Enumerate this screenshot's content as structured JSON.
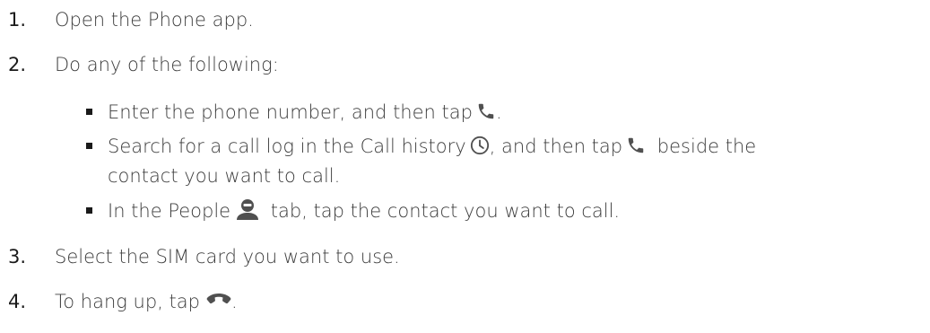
{
  "steps": [
    {
      "number": "1.",
      "text": "Open the Phone app."
    },
    {
      "number": "2.",
      "text": "Do any of the following:"
    },
    {
      "number": "3.",
      "text": "Select the SIM card you want to use."
    },
    {
      "number": "4.",
      "text_before": "To hang up, tap",
      "icon": "hang-up-icon",
      "text_after": "."
    }
  ],
  "bullets": [
    {
      "text_before": "Enter the phone number, and then tap",
      "icon": "phone-call-icon",
      "text_after": "."
    },
    {
      "line1_part1": "Search for a call log in the Call history",
      "icon1": "clock-icon",
      "line1_part2": ", and then tap",
      "icon2": "phone-call-icon",
      "line1_part3": "beside the",
      "line2": "contact you want to call."
    },
    {
      "text_before": "In the People",
      "icon": "person-icon",
      "text_after": "tab, tap the contact you want to call."
    }
  ],
  "colors": {
    "text": "#3c3c3c",
    "icon": "#505050"
  }
}
